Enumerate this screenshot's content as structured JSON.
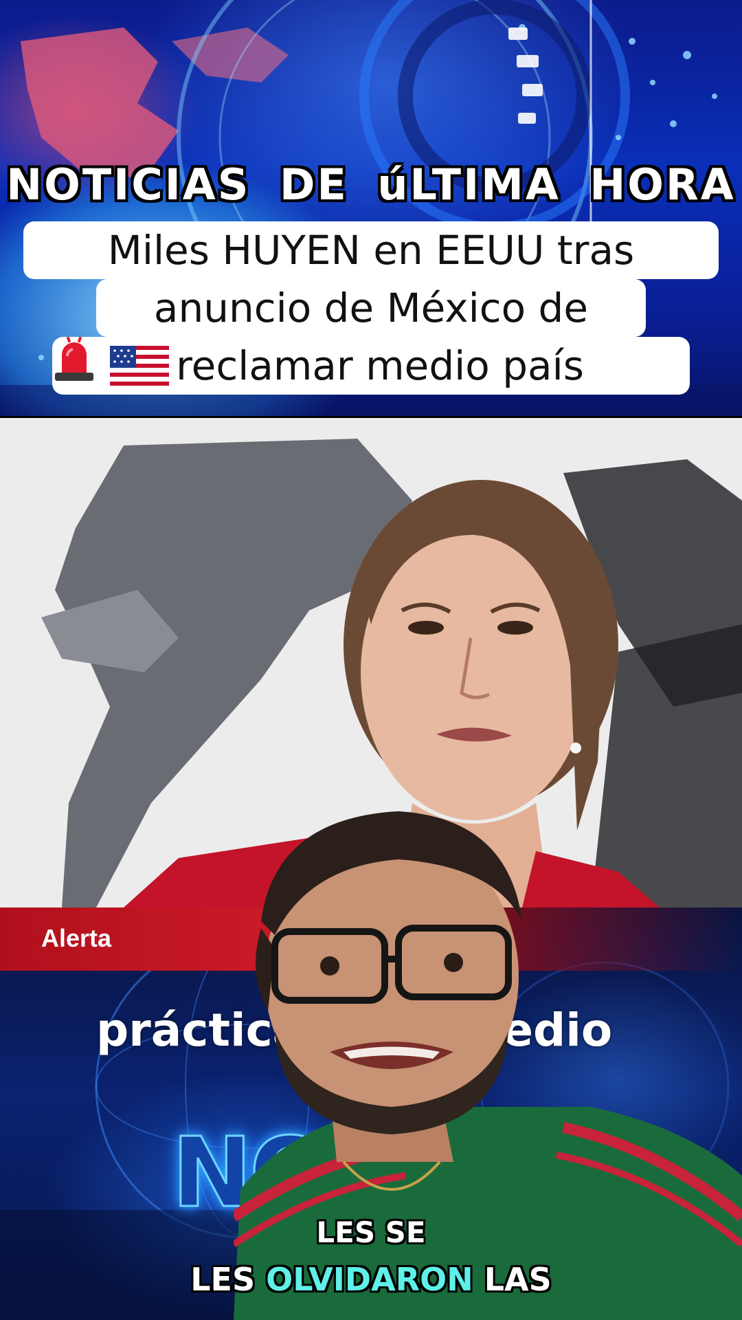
{
  "banner": {
    "kicker": "NOTICIAS  DE  úLTIMA  HORA",
    "caption_line_1": "Miles HUYEN en EEUU tras",
    "caption_line_2": "anuncio de México de",
    "caption_line_3": "reclamar medio país"
  },
  "icons": {
    "flag": "us-flag-icon",
    "siren": "siren-icon"
  },
  "alert": {
    "label": "Alerta",
    "background_text_left": "práctica",
    "background_text_right": "edio",
    "background_logo": "NO"
  },
  "subtitles": {
    "line_top": "LES SE",
    "line_bottom_prefix": "LES",
    "line_bottom_highlight": "OLVIDARON",
    "line_bottom_suffix": "LAS"
  },
  "colors": {
    "alert_red": "#c91a26",
    "subtitle_highlight": "#5ff0e8",
    "banner_blue": "#0a2fb8"
  }
}
